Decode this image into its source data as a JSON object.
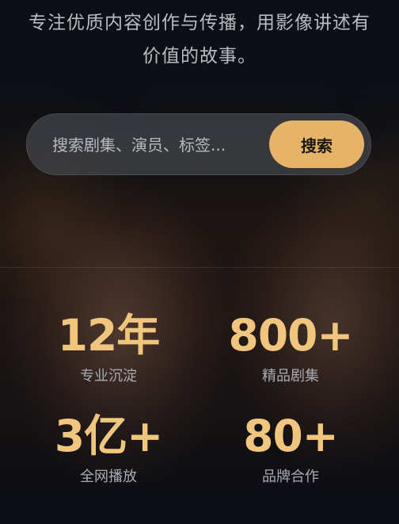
{
  "hero": {
    "tagline": "专注优质内容创作与传播，用影像讲述有价值的故事。"
  },
  "search": {
    "placeholder": "搜索剧集、演员、标签...",
    "value": "",
    "button_label": "搜索"
  },
  "stats": [
    {
      "value": "12年",
      "label": "专业沉淀"
    },
    {
      "value": "800+",
      "label": "精品剧集"
    },
    {
      "value": "3亿+",
      "label": "全网播放"
    },
    {
      "value": "80+",
      "label": "品牌合作"
    }
  ],
  "colors": {
    "accent": "#e5b468",
    "stat_value": "#f0c57e",
    "background": "#0c0f16"
  }
}
